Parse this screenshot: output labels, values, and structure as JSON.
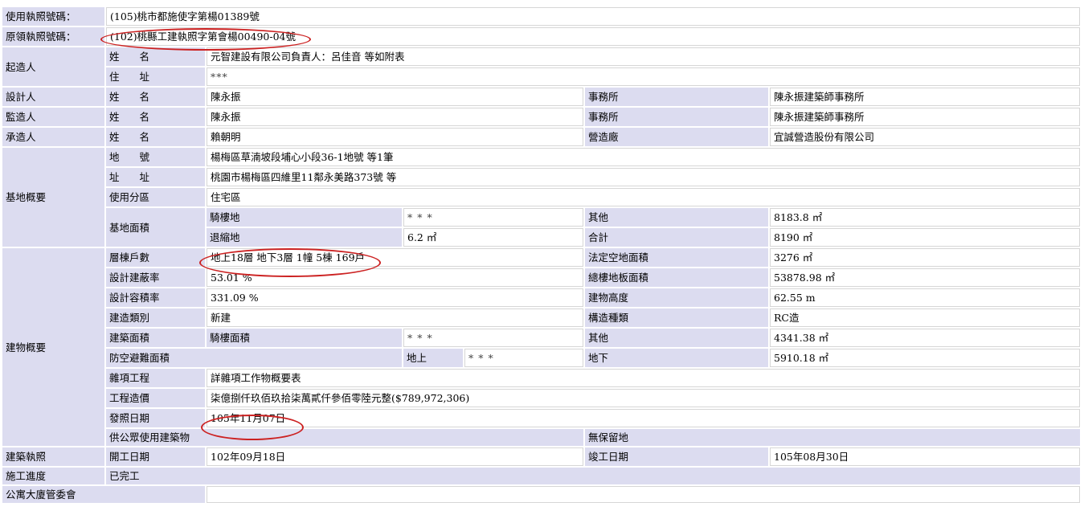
{
  "permit_no": {
    "label": "使用執照號碼：",
    "value": "(105)桃市都施使字第楊01389號"
  },
  "orig_no": {
    "label": "原領執照號碼：",
    "value": "(102)桃縣工建執照字第會楊00490-04號"
  },
  "applicant": {
    "label": "起造人",
    "name_label": "姓　　名",
    "name": "元智建設有限公司負責人：呂佳音 等如附表",
    "addr_label": "住　　址",
    "addr": "***"
  },
  "designer": {
    "label": "設計人",
    "name_label": "姓　　名",
    "name": "陳永振",
    "office_label": "事務所",
    "office": "陳永振建築師事務所"
  },
  "supervisor": {
    "label": "監造人",
    "name_label": "姓　　名",
    "name": "陳永振",
    "office_label": "事務所",
    "office": "陳永振建築師事務所"
  },
  "contractor": {
    "label": "承造人",
    "name_label": "姓　　名",
    "name": "賴朝明",
    "firm_label": "營造廠",
    "firm": "宜誠營造股份有限公司"
  },
  "site": {
    "label": "基地概要",
    "lot_label": "地　　號",
    "lot": "楊梅區草湳坡段埔心小段36-1地號 等1筆",
    "addr_label": "址　　址",
    "addr": "桃園市楊梅區四維里11鄰永美路373號 等",
    "zone_label": "使用分區",
    "zone": "住宅區",
    "area_label": "基地面積",
    "arcade_label": "騎樓地",
    "arcade": "* * *",
    "other_label": "其他",
    "other": "8183.8 ㎡",
    "setback_label": "退縮地",
    "setback": "6.2 ㎡",
    "total_label": "合計",
    "total": "8190 ㎡"
  },
  "building": {
    "label": "建物概要",
    "floors_label": "層棟戶數",
    "floors": "地上18層 地下3層 1幢 5棟 169戶",
    "open_label": "法定空地面積",
    "open": "3276 ㎡",
    "bcr_label": "設計建蔽率",
    "bcr": "53.01 %",
    "gfa_label": "總樓地板面積",
    "gfa": "53878.98 ㎡",
    "far_label": "設計容積率",
    "far": "331.09 %",
    "height_label": "建物高度",
    "height": "62.55 m",
    "type_label": "建造類別",
    "type": "新建",
    "struct_label": "構造種類",
    "struct": "RC造",
    "barea_label": "建築面積",
    "arcade_label": "騎樓面積",
    "arcade": "* * *",
    "other_label": "其他",
    "other": "4341.38 ㎡",
    "shelter_label": "防空避難面積",
    "above_label": "地上",
    "above": "* * *",
    "below_label": "地下",
    "below": "5910.18 ㎡",
    "misc_label": "雜項工程",
    "misc": "詳雜項工作物概要表",
    "cost_label": "工程造價",
    "cost": "柒億捌仟玖佰玖拾柒萬貳仟參佰零陸元整($789,972,306)",
    "issue_label": "發照日期",
    "issue": "105年11月07日",
    "public_label": "供公眾使用建築物",
    "reserve_label": "無保留地"
  },
  "license": {
    "label": "建築執照",
    "start_label": "開工日期",
    "start": "102年09月18日",
    "end_label": "竣工日期",
    "end": "105年08月30日"
  },
  "progress": {
    "label": "施工進度",
    "value": "已完工"
  },
  "committee": {
    "label": "公寓大廈管委會"
  }
}
